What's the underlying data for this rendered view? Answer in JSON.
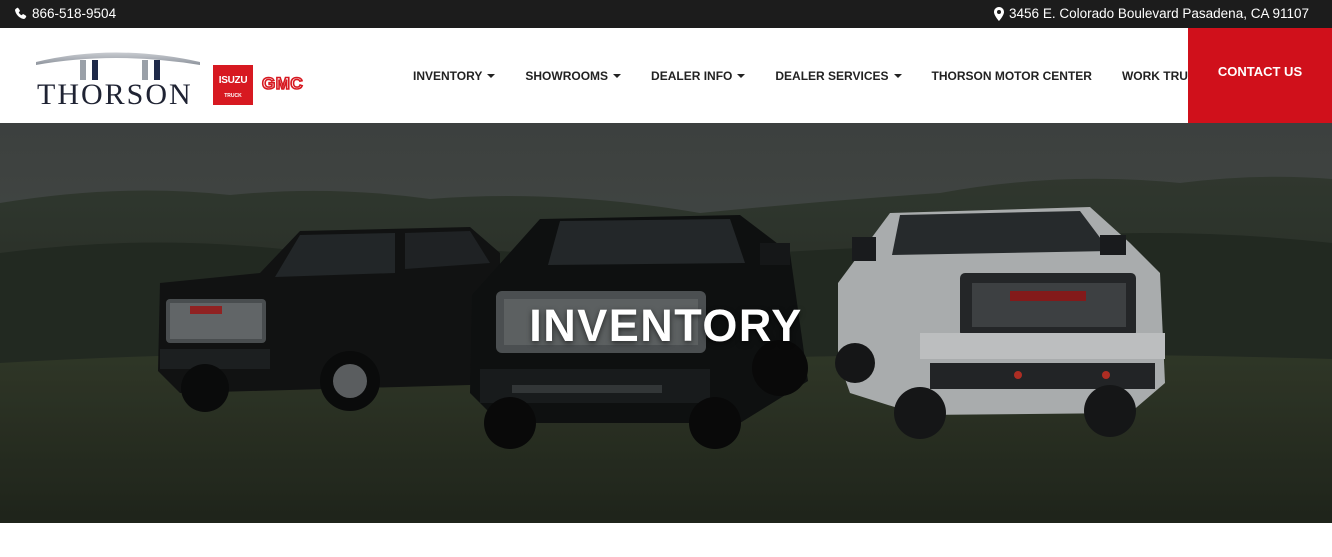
{
  "topbar": {
    "phone": "866-518-9504",
    "phone_icon": "phone-icon",
    "address": "3456 E. Colorado Boulevard Pasadena, CA 91107",
    "address_icon": "map-pin-icon"
  },
  "brand": {
    "logo_text": "THORSON",
    "isuzu_badge": "ISUZU",
    "isuzu_sub": "TRUCK",
    "gmc": "GMC",
    "accent_color": "#d0101b"
  },
  "nav": {
    "items": [
      {
        "label": "INVENTORY"
      },
      {
        "label": "SHOWROOMS"
      },
      {
        "label": "DEALER INFO"
      },
      {
        "label": "DEALER SERVICES"
      },
      {
        "label": "THORSON MOTOR CENTER"
      },
      {
        "label": "WORK TRUCKS"
      }
    ],
    "contact": "CONTACT US"
  },
  "hero": {
    "title": "INVENTORY"
  }
}
